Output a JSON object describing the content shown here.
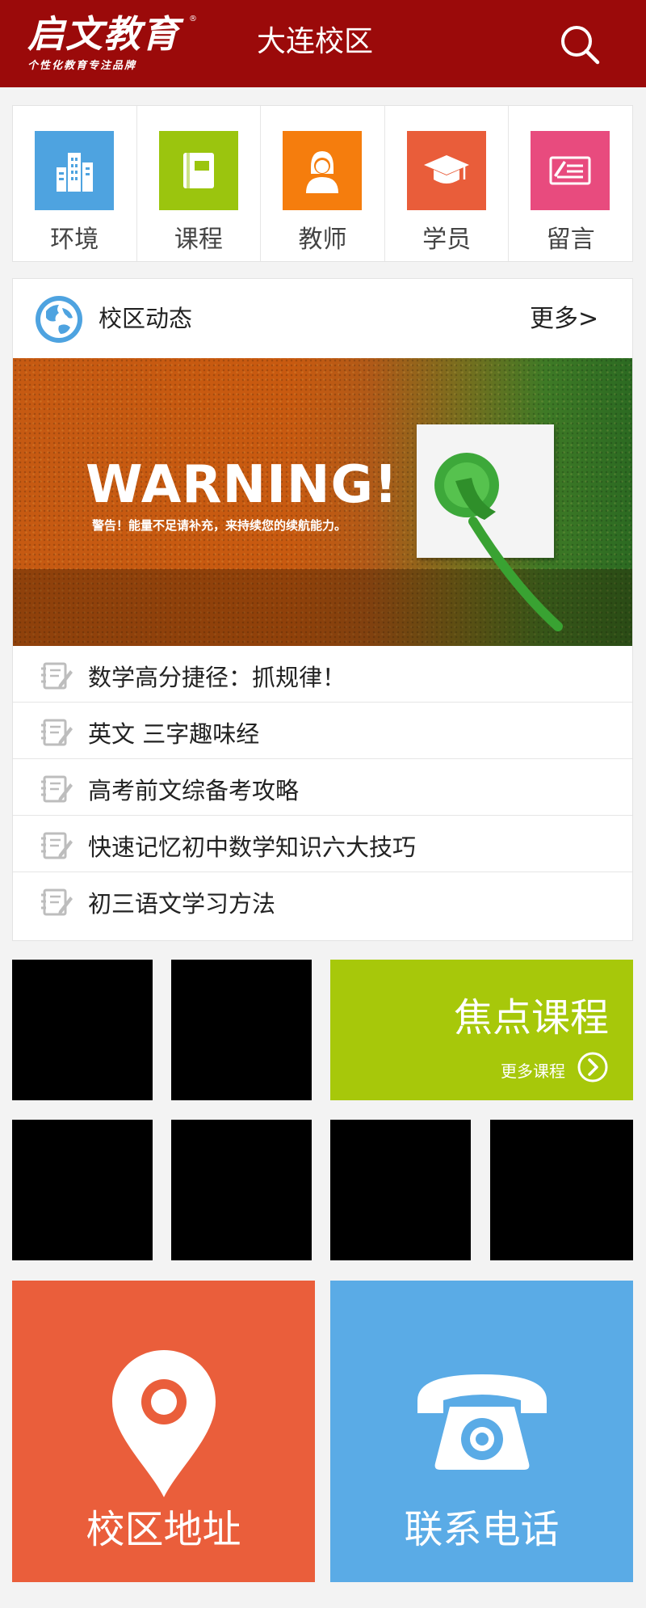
{
  "header": {
    "logo_main": "启文教育",
    "logo_reg": "®",
    "logo_tagline": "个性化教育专注品牌",
    "campus": "大连校区",
    "search_icon": "search-icon"
  },
  "categories": [
    {
      "label": "环境",
      "icon": "building-icon",
      "color": "#4ea3e0"
    },
    {
      "label": "课程",
      "icon": "book-icon",
      "color": "#9bc50e"
    },
    {
      "label": "教师",
      "icon": "teacher-icon",
      "color": "#f57d0d"
    },
    {
      "label": "学员",
      "icon": "graduation-cap-icon",
      "color": "#e95d3a"
    },
    {
      "label": "留言",
      "icon": "message-icon",
      "color": "#e84b7e"
    }
  ],
  "news": {
    "title": "校区动态",
    "more": "更多>",
    "banner": {
      "headline": "WARNING!",
      "subline": "警告！能量不足请补充，来持续您的续航能力。"
    },
    "items": [
      "数学高分捷径：抓规律！",
      "英文 三字趣味经",
      "高考前文综备考攻略",
      "快速记忆初中数学知识六大技巧",
      "初三语文学习方法"
    ]
  },
  "focus": {
    "title": "焦点课程",
    "more": "更多课程",
    "color": "#a7c80a"
  },
  "contact": {
    "address_label": "校区地址",
    "address_color": "#ea5e3b",
    "phone_label": "联系电话",
    "phone_color": "#5aabe6"
  }
}
